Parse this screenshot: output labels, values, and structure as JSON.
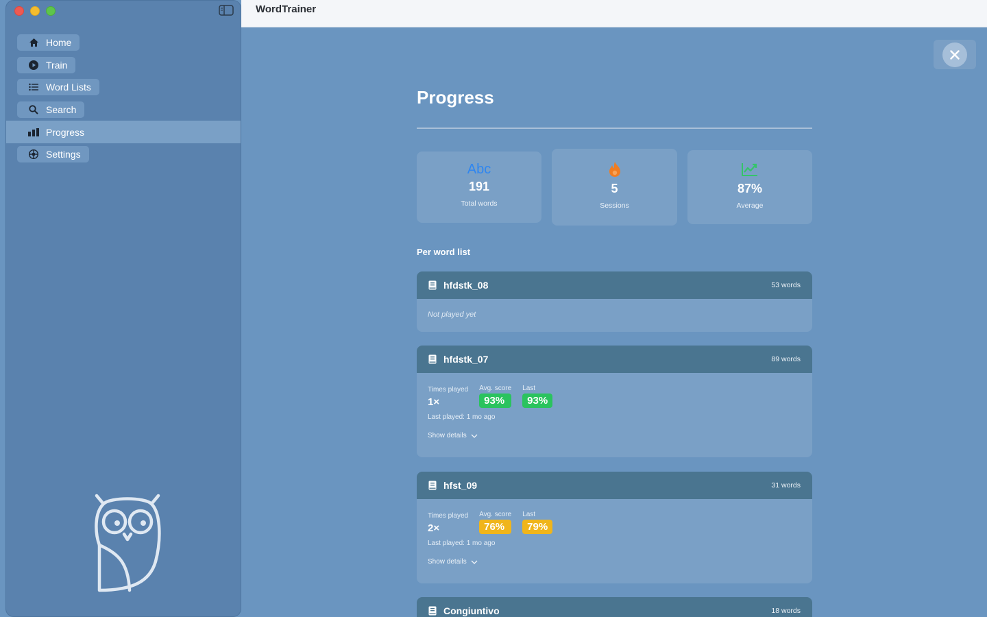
{
  "app": {
    "title": "WordTrainer"
  },
  "sidebar": {
    "items": [
      {
        "label": "Home",
        "icon": "house-icon"
      },
      {
        "label": "Train",
        "icon": "play-circle-icon"
      },
      {
        "label": "Word Lists",
        "icon": "list-icon"
      },
      {
        "label": "Search",
        "icon": "search-icon"
      },
      {
        "label": "Progress",
        "icon": "bar-chart-icon",
        "active": true
      },
      {
        "label": "Settings",
        "icon": "gear-icon"
      }
    ]
  },
  "page": {
    "title": "Progress",
    "stats": [
      {
        "icon": "abc-icon",
        "icon_text": "Abc",
        "value": "191",
        "label": "Total words",
        "icon_color": "#2f86f0"
      },
      {
        "icon": "flame-icon",
        "value": "5",
        "label": "Sessions",
        "icon_color": "#f07d22"
      },
      {
        "icon": "trend-chart-icon",
        "value": "87%",
        "label": "Average",
        "icon_color": "#35c46a"
      }
    ],
    "section_label": "Per word list",
    "lists": [
      {
        "name": "hfdstk_08",
        "count": "53 words",
        "status": "Not played yet"
      },
      {
        "name": "hfdstk_07",
        "count": "89 words",
        "times_label": "Times played",
        "times": "1×",
        "avg_label": "Avg. score",
        "avg": "93%",
        "avg_color": "green",
        "last_label": "Last",
        "last": "93%",
        "last_color": "green",
        "last_played": "Last played: 1 mo ago",
        "details": "Show details"
      },
      {
        "name": "hfst_09",
        "count": "31 words",
        "times_label": "Times played",
        "times": "2×",
        "avg_label": "Avg. score",
        "avg": "76%",
        "avg_color": "yellow",
        "last_label": "Last",
        "last": "79%",
        "last_color": "yellow",
        "last_played": "Last played: 1 mo ago",
        "details": "Show details"
      },
      {
        "name": "Congiuntivo",
        "count": "18 words"
      }
    ]
  },
  "colors": {
    "accent_green": "#2ac35e",
    "accent_yellow": "#f0b51b",
    "header_teal": "#4a7590"
  }
}
